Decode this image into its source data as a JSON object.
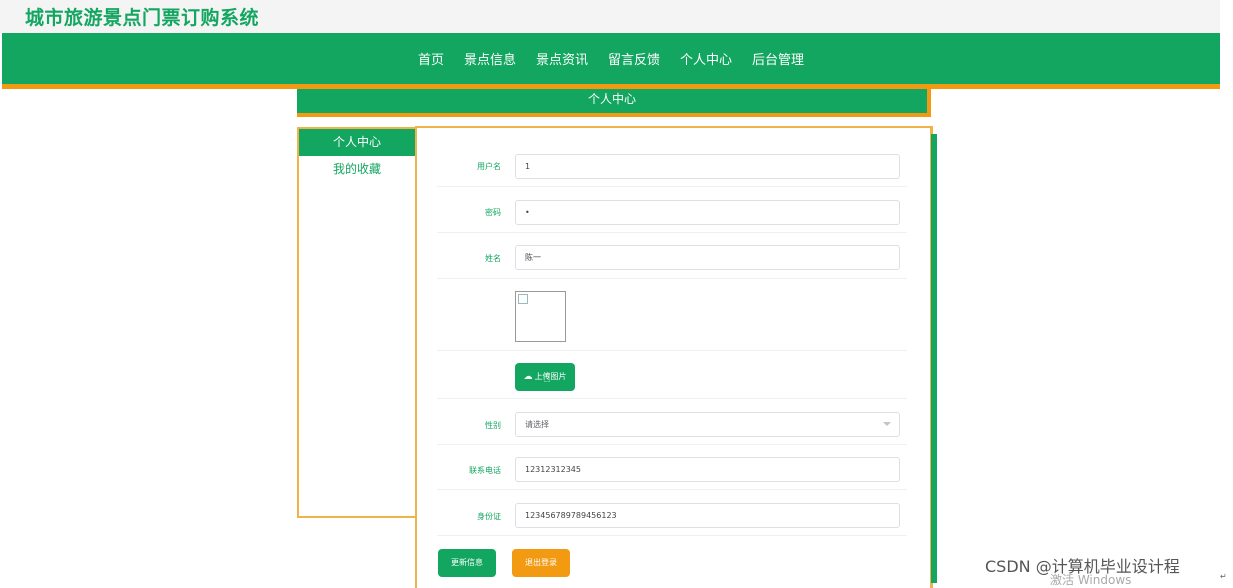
{
  "app": {
    "title": "城市旅游景点门票订购系统"
  },
  "nav": {
    "items": [
      "首页",
      "景点信息",
      "景点资讯",
      "留言反馈",
      "个人中心",
      "后台管理"
    ]
  },
  "page": {
    "title": "个人中心"
  },
  "sidebar": {
    "items": [
      {
        "label": "个人中心",
        "active": true
      },
      {
        "label": "我的收藏",
        "active": false
      }
    ]
  },
  "form": {
    "username": {
      "label": "用户名",
      "value": "1"
    },
    "password": {
      "label": "密码",
      "value": "•"
    },
    "name": {
      "label": "姓名",
      "value": "陈一"
    },
    "upload_label": "上传图片",
    "gender": {
      "label": "性别",
      "placeholder": "请选择"
    },
    "phone": {
      "label": "联系电话",
      "value": "12312312345"
    },
    "id_card": {
      "label": "身份证",
      "value": "123456789789456123"
    },
    "update_label": "更新信息",
    "logout_label": "退出登录"
  },
  "colors": {
    "primary": "#13a660",
    "accent": "#f39a13"
  },
  "watermark": {
    "text": "CSDN @计算机毕业设计程",
    "windows": "激活 Windows"
  }
}
